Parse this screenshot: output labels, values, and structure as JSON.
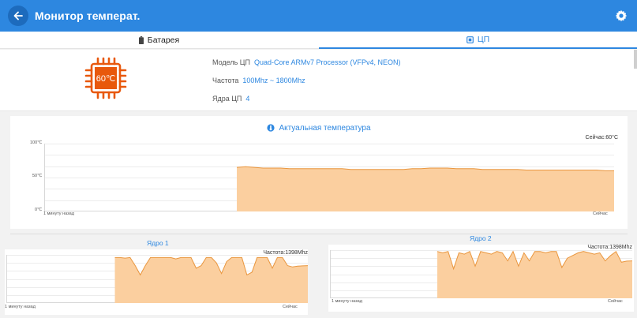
{
  "header": {
    "title": "Монитор температ.",
    "back_icon": "arrow-left-icon",
    "settings_icon": "gear-icon",
    "color": "#2d87e0"
  },
  "tabs": [
    {
      "label": "Батарея",
      "icon": "battery-icon",
      "active": false
    },
    {
      "label": "ЦП",
      "icon": "cpu-icon",
      "active": true
    }
  ],
  "cpu_info": {
    "temperature": "60℃",
    "model_label": "Модель ЦП",
    "model_value": "Quad-Core ARMv7 Processor (VFPv4, NEON)",
    "freq_label": "Частота",
    "freq_value": "100Mhz ~ 1800Mhz",
    "cores_label": "Ядра ЦП",
    "cores_value": "4"
  },
  "main_chart": {
    "title": "Актуальная температура",
    "icon": "thermometer-icon",
    "now": "Сейчас:60°C",
    "y_ticks": [
      "100℃",
      "50℃",
      "0℃"
    ],
    "x_start": "1 минуту назад",
    "x_end": "Сейчас"
  },
  "core1": {
    "title": "Ядро 1",
    "freq": "Частота:1398Mhz",
    "x_start": "1 минуту назад",
    "x_end": "Сейчас"
  },
  "core2": {
    "title": "Ядро 2",
    "freq": "Частота:1398Mhz",
    "x_start": "1 минуту назад",
    "x_end": "Сейчас"
  },
  "chart_data": [
    {
      "type": "area",
      "title": "Актуальная температура",
      "ylim": [
        0,
        100
      ],
      "y_ticks": [
        0,
        50,
        100
      ],
      "x_range": [
        "1 минуту назад",
        "Сейчас"
      ],
      "start_fraction": 0.338,
      "values": [
        65,
        66,
        65,
        64,
        64,
        64,
        63,
        63,
        63,
        63,
        63,
        63,
        63,
        62,
        62,
        62,
        62,
        62,
        62,
        62,
        63,
        63,
        64,
        64,
        64,
        63,
        63,
        63,
        62,
        62,
        62,
        62,
        62,
        61,
        61,
        61,
        61,
        61,
        61,
        61,
        61,
        61,
        60,
        60
      ]
    },
    {
      "type": "area",
      "title": "Ядро 1",
      "ylim": [
        0,
        1800
      ],
      "x_range": [
        "1 минуту назад",
        "Сейчас"
      ],
      "start_fraction": 0.36,
      "values": [
        1700,
        1700,
        1680,
        1700,
        1400,
        1050,
        1400,
        1700,
        1700,
        1700,
        1700,
        1700,
        1650,
        1700,
        1700,
        1700,
        1300,
        1400,
        1700,
        1700,
        1500,
        1100,
        1550,
        1700,
        1700,
        1700,
        1050,
        1150,
        1700,
        1700,
        1700,
        1300,
        1700,
        1700,
        1400,
        1350,
        1380,
        1390,
        1398
      ]
    },
    {
      "type": "area",
      "title": "Ядро 2",
      "ylim": [
        0,
        1800
      ],
      "x_range": [
        "1 минуту назад",
        "Сейчас"
      ],
      "start_fraction": 0.355,
      "values": [
        1750,
        1700,
        1750,
        1100,
        1700,
        1650,
        1750,
        1200,
        1750,
        1700,
        1650,
        1750,
        1700,
        1400,
        1750,
        1200,
        1700,
        1400,
        1750,
        1750,
        1700,
        1750,
        1750,
        1150,
        1500,
        1600,
        1700,
        1750,
        1700,
        1650,
        1700,
        1400,
        1600,
        1750,
        1350,
        1390,
        1398
      ]
    }
  ]
}
